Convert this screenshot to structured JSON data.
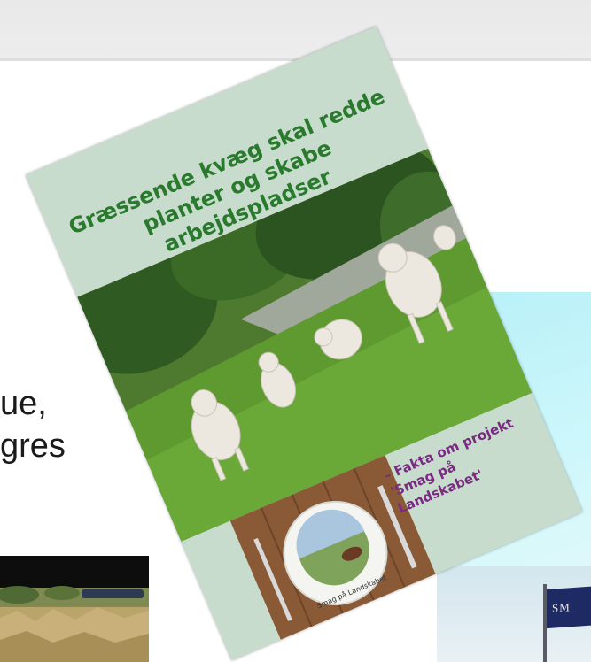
{
  "slide": {
    "line_1": "ue,",
    "line_2": "gres"
  },
  "cover": {
    "title_line_1": "Græssende kvæg skal redde",
    "title_line_2": "planter og skabe arbejdspladser",
    "fact_line_1": "– Fakta om projekt",
    "fact_line_2": "'Smag på Landskabet'",
    "plate_caption": "Smag på Landskabet"
  },
  "flag": {
    "text": "SM"
  },
  "colors": {
    "cover_background": "#c8dccd",
    "title_green": "#2a7a2e",
    "fact_purple": "#7a2a83",
    "flag_navy": "#1e2a63"
  }
}
